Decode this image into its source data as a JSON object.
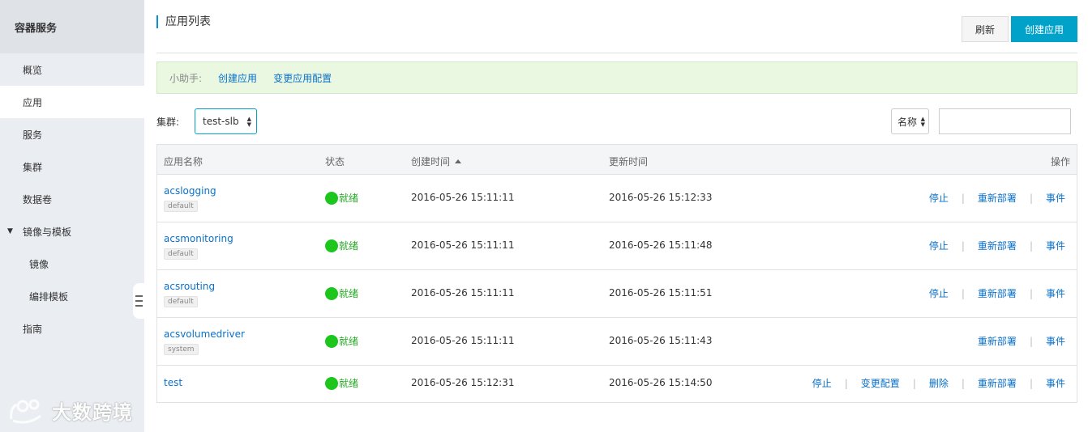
{
  "sidebar": {
    "title": "容器服务",
    "items": [
      {
        "label": "概览"
      },
      {
        "label": "应用"
      },
      {
        "label": "服务"
      },
      {
        "label": "集群"
      },
      {
        "label": "数据卷"
      },
      {
        "label": "镜像与模板"
      },
      {
        "label": "镜像"
      },
      {
        "label": "编排模板"
      },
      {
        "label": "指南"
      }
    ]
  },
  "watermark": {
    "text": "大数跨境"
  },
  "header": {
    "title": "应用列表",
    "refresh_label": "刷新",
    "create_label": "创建应用"
  },
  "helper": {
    "label": "小助手:",
    "links": [
      "创建应用",
      "变更应用配置"
    ]
  },
  "filters": {
    "cluster_label": "集群:",
    "cluster_value": "test-slb",
    "name_select_value": "名称",
    "search_value": ""
  },
  "table": {
    "headers": {
      "name": "应用名称",
      "status": "状态",
      "created": "创建时间",
      "updated": "更新时间",
      "actions": "操作"
    },
    "rows": [
      {
        "name": "acslogging",
        "tag": "default",
        "status": "就绪",
        "created": "2016-05-26 15:11:11",
        "updated": "2016-05-26 15:12:33",
        "actions": [
          "停止",
          "重新部署",
          "事件"
        ]
      },
      {
        "name": "acsmonitoring",
        "tag": "default",
        "status": "就绪",
        "created": "2016-05-26 15:11:11",
        "updated": "2016-05-26 15:11:48",
        "actions": [
          "停止",
          "重新部署",
          "事件"
        ]
      },
      {
        "name": "acsrouting",
        "tag": "default",
        "status": "就绪",
        "created": "2016-05-26 15:11:11",
        "updated": "2016-05-26 15:11:51",
        "actions": [
          "停止",
          "重新部署",
          "事件"
        ]
      },
      {
        "name": "acsvolumedriver",
        "tag": "system",
        "status": "就绪",
        "created": "2016-05-26 15:11:11",
        "updated": "2016-05-26 15:11:43",
        "actions": [
          "重新部署",
          "事件"
        ]
      },
      {
        "name": "test",
        "tag": "",
        "status": "就绪",
        "created": "2016-05-26 15:12:31",
        "updated": "2016-05-26 15:14:50",
        "actions": [
          "停止",
          "变更配置",
          "删除",
          "重新部署",
          "事件"
        ]
      }
    ]
  }
}
